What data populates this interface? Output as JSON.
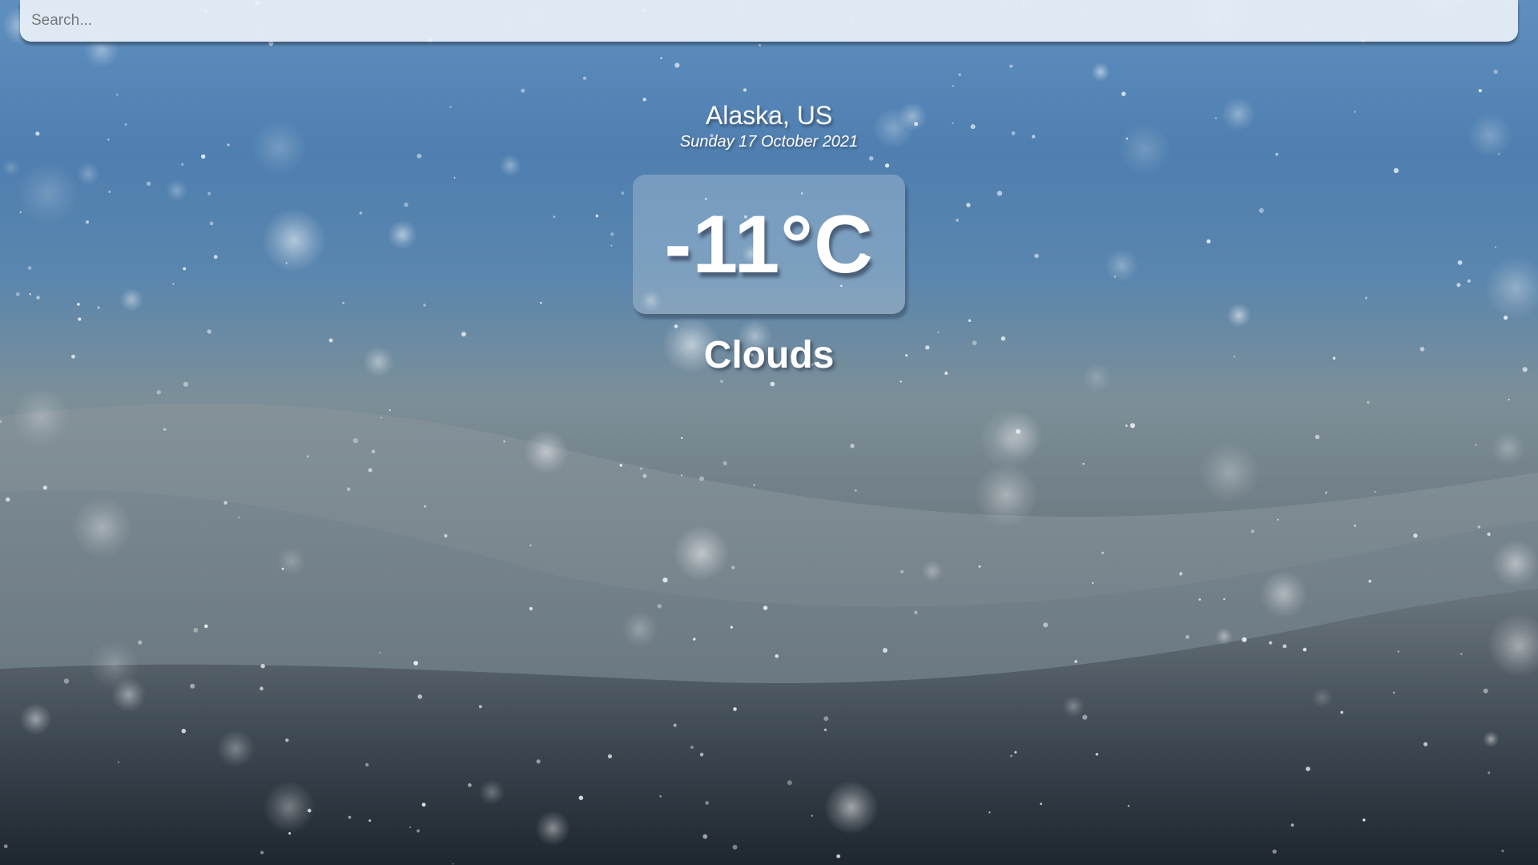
{
  "search": {
    "placeholder": "Search...",
    "value": ""
  },
  "location": {
    "name": "Alaska, US",
    "date": "Sunday 17 October 2021"
  },
  "weather": {
    "temperature": "-11°C",
    "condition": "Clouds"
  },
  "theme": {
    "sky_top": "#5f8fbf",
    "snow_hills": "#7c8f98",
    "ground_dark": "#222b33",
    "text": "#ffffff"
  }
}
